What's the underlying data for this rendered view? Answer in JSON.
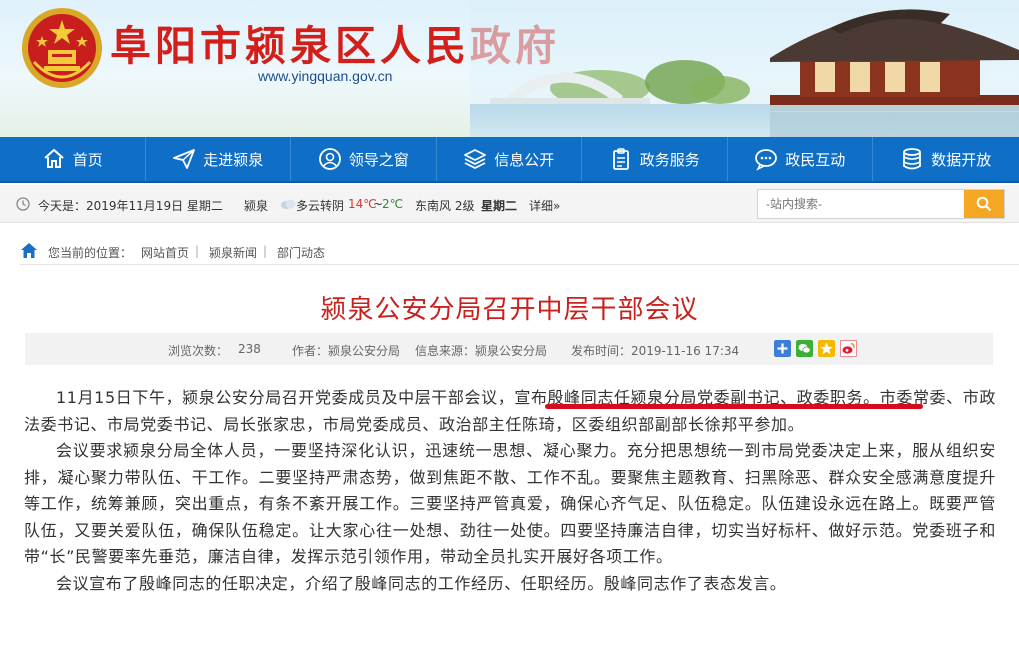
{
  "header": {
    "site_title": "阜阳市颍泉区人民政府",
    "site_url": "www.yingquan.gov.cn"
  },
  "nav": {
    "items": [
      {
        "label": "首页",
        "icon": "home-icon"
      },
      {
        "label": "走进颍泉",
        "icon": "paper-plane-icon"
      },
      {
        "label": "领导之窗",
        "icon": "user-icon"
      },
      {
        "label": "信息公开",
        "icon": "layers-icon"
      },
      {
        "label": "政务服务",
        "icon": "clipboard-icon"
      },
      {
        "label": "民互动",
        "label_full": "政民互动",
        "icon": "chat-icon"
      },
      {
        "label": "数据开放",
        "icon": "database-icon"
      }
    ]
  },
  "infobar": {
    "date": "今天是：2019年11月19日 星期二",
    "city": "颍泉",
    "weather": "多云转阴",
    "temp_high": "14℃",
    "temp_sep": "~",
    "temp_low": "2℃",
    "wind": "东南风 2级",
    "weekday": "星期二",
    "details": "详细»",
    "search_placeholder": "-站内搜索-"
  },
  "breadcrumb": {
    "prefix": "您当前的位置：",
    "items": [
      "网站首页",
      "颍泉新闻",
      "部门动态"
    ],
    "sep": "|"
  },
  "article": {
    "title": "颍泉公安分局召开中层干部会议",
    "views_label": "浏览次数：",
    "views": "238",
    "author": "作者：颍泉公安分局",
    "source": "信息来源：颍泉公安分局",
    "publish_time": "发布时间：2019-11-16 17:34",
    "p1_before": "11月15日下午，颍泉公安分局召开党委成员及中层干部会议，",
    "p1_highlight": "宣布殷峰同志任颍泉分局党委副书记、政委职务",
    "p1_after": "。市委常委、市政法委书记、市局党委书记、局长张家忠，市局党委成员、政治部主任陈琦，区委组织部副部长徐邦平参加。",
    "p2": "会议要求颍泉分局全体人员，一要坚持深化认识，迅速统一思想、凝心聚力。充分把思想统一到市局党委决定上来，服从组织安排，凝心聚力带队伍、干工作。二要坚持严肃态势，做到焦距不散、工作不乱。要聚焦主题教育、扫黑除恶、群众安全感满意度提升等工作，统筹兼顾，突出重点，有条不紊开展工作。三要坚持严管真爱，确保心齐气足、队伍稳定。队伍建设永远在路上。既要严管队伍，又要关爱队伍，确保队伍稳定。让大家心往一处想、劲往一处使。四要坚持廉洁自律，切实当好标杆、做好示范。党委班子和带“长”民警要率先垂范，廉洁自律，发挥示范引领作用，带动全员扎实开展好各项工作。",
    "p3": "会议宣布了殷峰同志的任职决定，介绍了殷峰同志的工作经历、任职经历。殷峰同志作了表态发言。"
  },
  "colors": {
    "nav_bg": "#0f6fc6",
    "title_red": "#c9211e",
    "site_title_red": "#d21f1a",
    "search_btn": "#f5a623",
    "highlight_underline": "#d40d1d"
  }
}
